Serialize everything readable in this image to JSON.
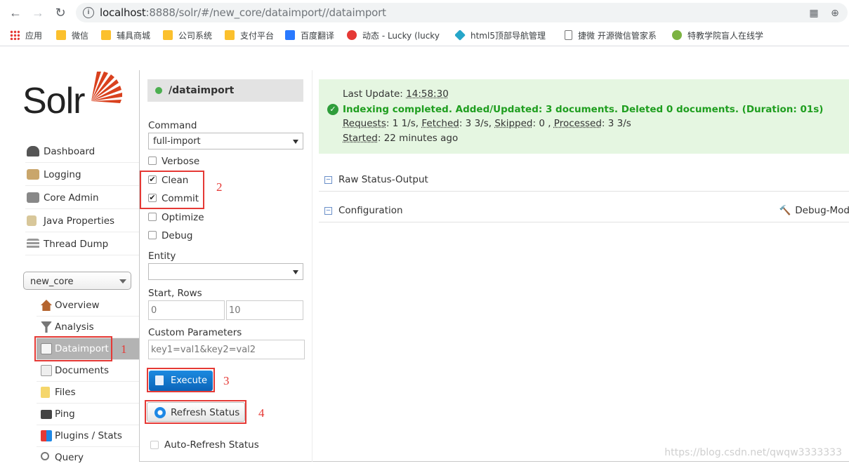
{
  "browser": {
    "url_host": "localhost",
    "url_rest": ":8888/solr/#/new_core/dataimport//dataimport",
    "bookmarks": [
      {
        "label": "应用",
        "icon": "apps-grid-icon"
      },
      {
        "label": "微信",
        "icon": "folder-icon"
      },
      {
        "label": "辅具商城",
        "icon": "folder-icon"
      },
      {
        "label": "公司系统",
        "icon": "folder-icon"
      },
      {
        "label": "支付平台",
        "icon": "folder-icon"
      },
      {
        "label": "百度翻译",
        "icon": "translate-icon"
      },
      {
        "label": "动态 - Lucky (lucky",
        "icon": "site-icon"
      },
      {
        "label": "html5顶部导航管理",
        "icon": "site-icon"
      },
      {
        "label": "捷微 开源微信管家系",
        "icon": "page-icon"
      },
      {
        "label": "特教学院盲人在线学",
        "icon": "site-icon"
      }
    ]
  },
  "sidebar": {
    "logo": "Solr",
    "items": [
      {
        "label": "Dashboard",
        "icon": "dashboard-icon"
      },
      {
        "label": "Logging",
        "icon": "logging-icon"
      },
      {
        "label": "Core Admin",
        "icon": "core-admin-icon"
      },
      {
        "label": "Java Properties",
        "icon": "java-icon"
      },
      {
        "label": "Thread Dump",
        "icon": "thread-dump-icon"
      }
    ],
    "core_selector": "new_core",
    "core_items": [
      {
        "label": "Overview",
        "icon": "home-icon"
      },
      {
        "label": "Analysis",
        "icon": "funnel-icon"
      },
      {
        "label": "Dataimport",
        "icon": "dataimport-icon"
      },
      {
        "label": "Documents",
        "icon": "documents-icon"
      },
      {
        "label": "Files",
        "icon": "folder-icon"
      },
      {
        "label": "Ping",
        "icon": "ping-icon"
      },
      {
        "label": "Plugins / Stats",
        "icon": "plugins-icon"
      },
      {
        "label": "Query",
        "icon": "query-icon"
      }
    ]
  },
  "form": {
    "handler": "/dataimport",
    "command_label": "Command",
    "command_value": "full-import",
    "verbose": "Verbose",
    "clean": "Clean",
    "commit": "Commit",
    "optimize": "Optimize",
    "debug": "Debug",
    "entity_label": "Entity",
    "entity_value": "",
    "start_rows_label": "Start, Rows",
    "start_value": "0",
    "rows_value": "10",
    "custom_label": "Custom Parameters",
    "custom_value": "key1=val1&key2=val2",
    "execute": "Execute",
    "refresh": "Refresh Status",
    "auto_refresh": "Auto-Refresh Status"
  },
  "annotations": [
    "1",
    "2",
    "3",
    "4"
  ],
  "status": {
    "last_update_label": "Last Update:",
    "last_update": "14:58:30",
    "message": "Indexing completed. Added/Updated: 3 documents. Deleted 0 documents. (Duration: 01s)",
    "requests_label": "Requests",
    "requests": ": 1 1/s,",
    "fetched_label": "Fetched",
    "fetched": ": 3 3/s,",
    "skipped_label": "Skipped",
    "skipped": ": 0 ,",
    "processed_label": "Processed",
    "processed": ": 3 3/s",
    "started_label": "Started",
    "started": ": 22 minutes ago"
  },
  "panels": {
    "raw_status": "Raw Status-Output",
    "configuration": "Configuration",
    "debug_mode": "Debug-Mod"
  },
  "watermark": "https://blog.csdn.net/qwqw3333333"
}
